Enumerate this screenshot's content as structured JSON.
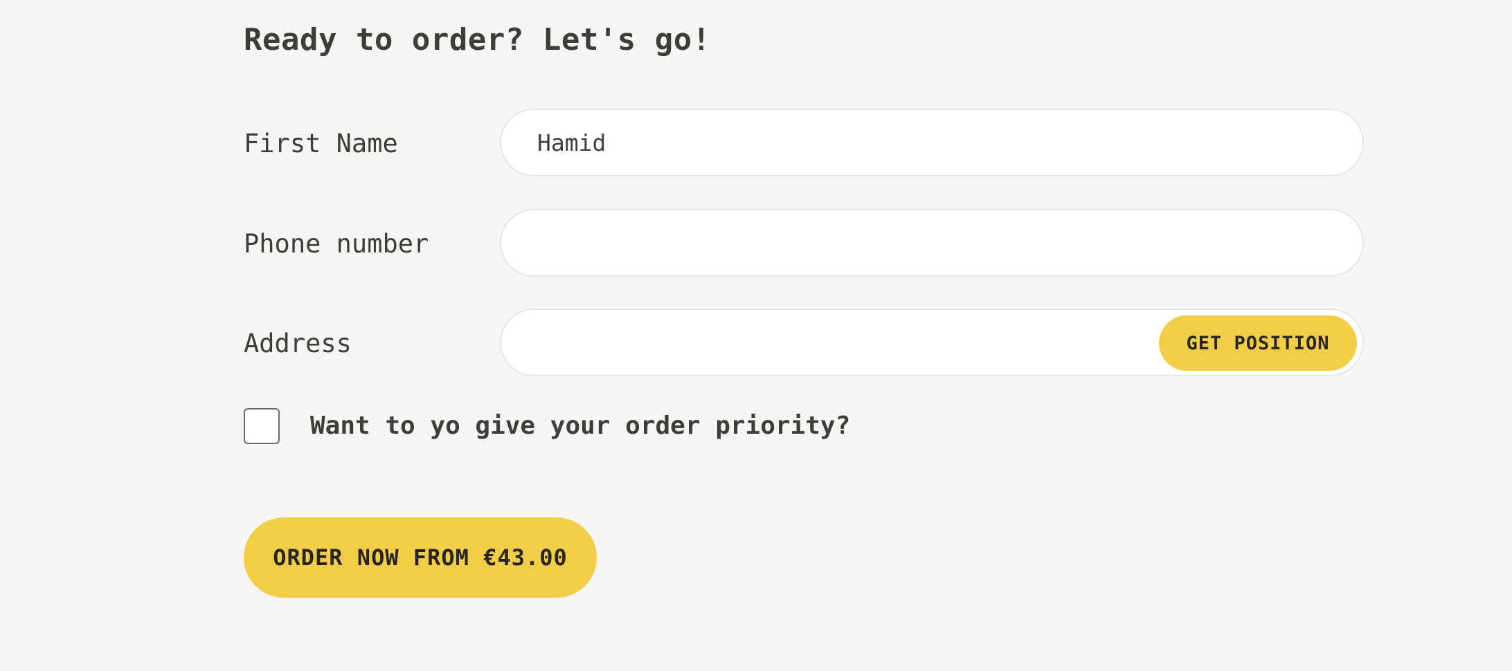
{
  "form": {
    "title": "Ready to order? Let's go!",
    "first_name": {
      "label": "First Name",
      "value": "Hamid"
    },
    "phone": {
      "label": "Phone number",
      "value": ""
    },
    "address": {
      "label": "Address",
      "value": "",
      "get_position_label": "GET POSITION"
    },
    "priority": {
      "label": "Want to yo give your order priority?",
      "checked": false
    },
    "submit_label": "ORDER NOW FROM €43.00"
  },
  "colors": {
    "background": "#f5f5f4",
    "accent": "#f2cd47",
    "text": "#3f3d3a",
    "input_border": "#e5e5e5"
  }
}
